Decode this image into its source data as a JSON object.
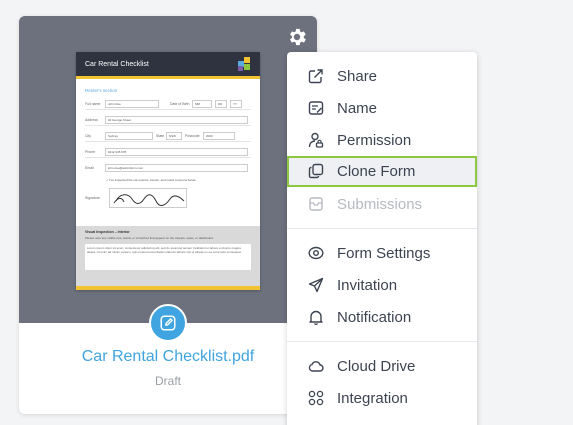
{
  "form_card": {
    "name": "Car Rental Checklist.pdf",
    "status": "Draft",
    "preview": {
      "title": "Car Rental Checklist",
      "section": "Renter's section",
      "fields": {
        "full_name_label": "Full name",
        "full_name_value": "John Doe",
        "dob_label": "Date of Birth",
        "dob_value": "MM",
        "dob_day": "DD",
        "dob_year": "YY",
        "address_label": "Address",
        "address_value": "32 George Street",
        "city_label": "City",
        "city_value": "Sydney",
        "state_label": "State",
        "state_value": "NSW",
        "postcode_label": "Postcode",
        "postcode_value": "2000",
        "phone_label": "Phone",
        "phone_value": "0412 345 678",
        "email_label": "Email",
        "email_value": "john.doe@adminform.com",
        "check_text": "I've inspected the car exterior, interior, and noted concerns below",
        "signature_label": "Signature"
      },
      "inspection_title": "Visual Inspection – Interior",
      "inspection_sub": "Please note any visible rips, stains, or scratches that appear on the carpets, seats, or dashboard",
      "inspection_text": "Lorem ipsum dolor sit amet, consectetur adipiscing elit, sed do eiusmod tempor incididunt ut labore et dolore magna aliqua. Ut enim ad minim veniam, quis nostrud exercitation ullamco laboris nisi ut aliquip ex ea commodo consequat."
    }
  },
  "menu": {
    "items": [
      {
        "label": "Share",
        "icon": "share-icon"
      },
      {
        "label": "Name",
        "icon": "rename-icon"
      },
      {
        "label": "Permission",
        "icon": "user-lock-icon"
      },
      {
        "label": "Clone Form",
        "icon": "clone-icon"
      },
      {
        "label": "Submissions",
        "icon": "submissions-icon"
      },
      {
        "label": "Form Settings",
        "icon": "eye-settings-icon"
      },
      {
        "label": "Invitation",
        "icon": "send-icon"
      },
      {
        "label": "Notification",
        "icon": "bell-icon"
      },
      {
        "label": "Cloud Drive",
        "icon": "cloud-icon"
      },
      {
        "label": "Integration",
        "icon": "integration-grid-icon"
      }
    ],
    "selected_index": 3,
    "disabled_index": 4
  },
  "colors": {
    "accent": "#3fa4df",
    "selected_outline": "#8dc63f",
    "card_preview_bg": "#6c717d"
  }
}
